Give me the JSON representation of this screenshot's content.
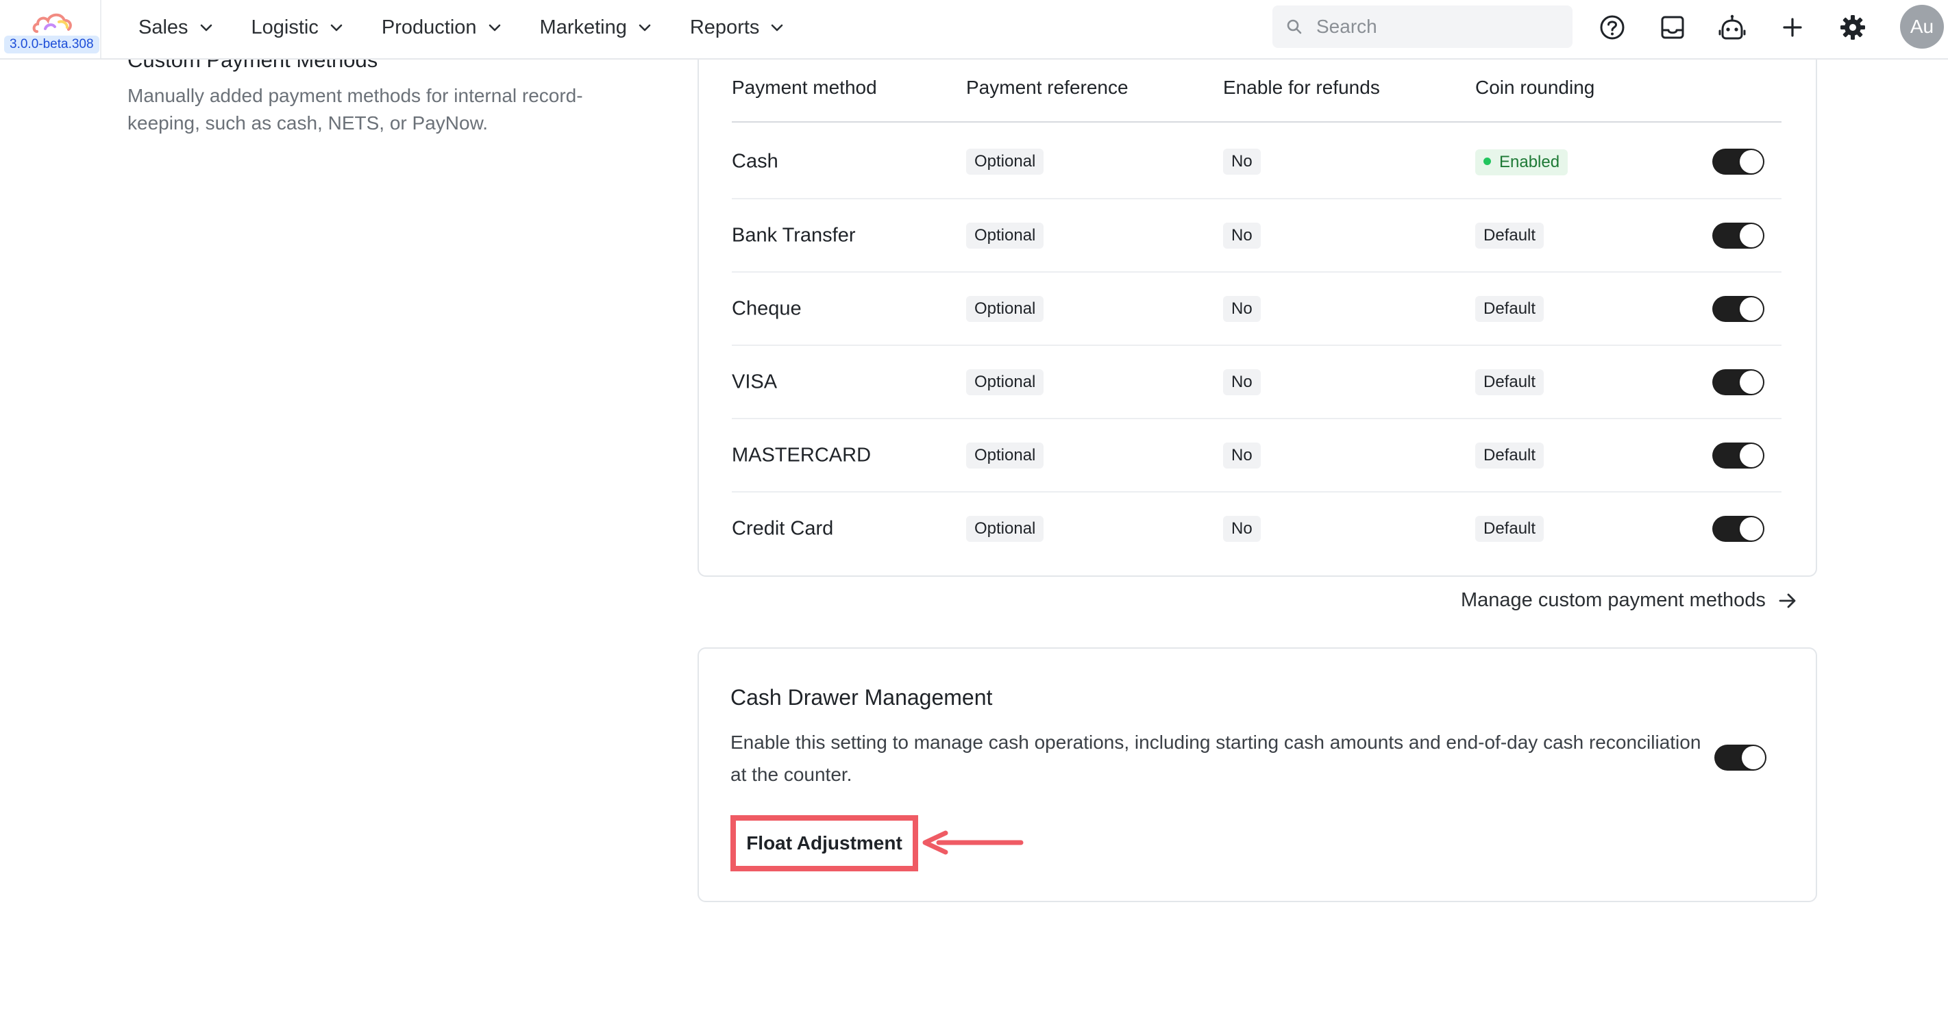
{
  "app": {
    "version": "3.0.0-beta.308",
    "logo_icon": "cloud-logo-icon"
  },
  "nav": {
    "items": [
      {
        "label": "Sales"
      },
      {
        "label": "Logistic"
      },
      {
        "label": "Production"
      },
      {
        "label": "Marketing"
      },
      {
        "label": "Reports"
      }
    ]
  },
  "search": {
    "placeholder": "Search"
  },
  "toolbar_icons": [
    "help-icon",
    "inbox-icon",
    "bot-icon",
    "plus-icon",
    "gear-icon"
  ],
  "user": {
    "initials": "Au"
  },
  "section": {
    "title": "Custom Payment Methods",
    "description": "Manually added payment methods for internal record-keeping, such as cash, NETS, or PayNow."
  },
  "payment_table": {
    "columns": [
      "Payment method",
      "Payment reference",
      "Enable for refunds",
      "Coin rounding"
    ],
    "rows": [
      {
        "method": "Cash",
        "reference": "Optional",
        "refunds": "No",
        "rounding": "Enabled",
        "active": true
      },
      {
        "method": "Bank Transfer",
        "reference": "Optional",
        "refunds": "No",
        "rounding": "Default",
        "active": true
      },
      {
        "method": "Cheque",
        "reference": "Optional",
        "refunds": "No",
        "rounding": "Default",
        "active": true
      },
      {
        "method": "VISA",
        "reference": "Optional",
        "refunds": "No",
        "rounding": "Default",
        "active": true
      },
      {
        "method": "MASTERCARD",
        "reference": "Optional",
        "refunds": "No",
        "rounding": "Default",
        "active": true
      },
      {
        "method": "Credit Card",
        "reference": "Optional",
        "refunds": "No",
        "rounding": "Default",
        "active": true
      }
    ],
    "manage_link": "Manage custom payment methods"
  },
  "cash_drawer": {
    "title": "Cash Drawer Management",
    "description": "Enable this setting to manage cash operations, including starting cash amounts and end-of-day cash reconciliation at the counter.",
    "enabled": true,
    "float_button": "Float Adjustment"
  },
  "colors": {
    "accent_annotation": "#ef5b64",
    "toggle_on": "#1f1f1f",
    "enabled_badge": "#1e7a36"
  }
}
